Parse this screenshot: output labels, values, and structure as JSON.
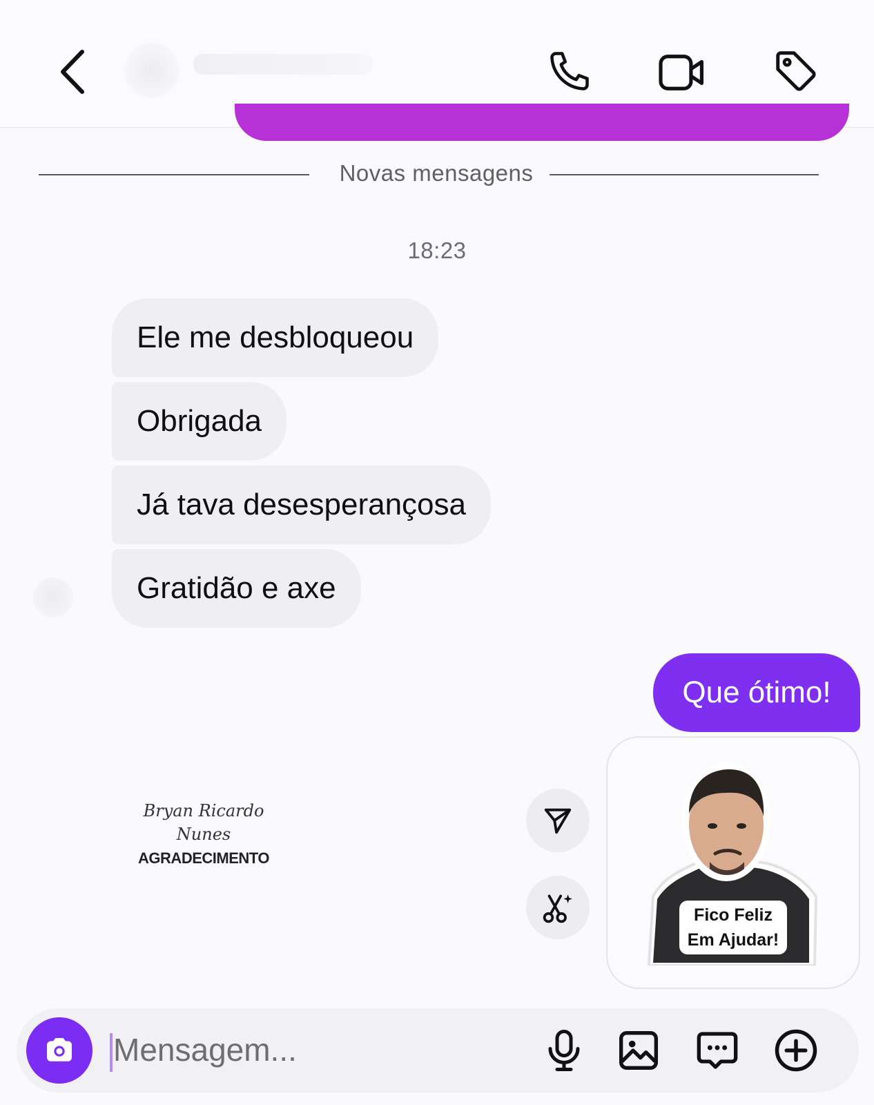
{
  "header": {
    "back_icon": "chevron-left-icon",
    "call_icon": "phone-icon",
    "video_icon": "video-camera-icon",
    "tag_icon": "tag-icon"
  },
  "chat": {
    "new_messages_label": "Novas mensagens",
    "timestamp": "18:23",
    "incoming": [
      "Ele me desbloqueou",
      "Obrigada",
      "Já tava desesperançosa",
      "Gratidão e axe"
    ],
    "outgoing": "Que ótimo!",
    "card": {
      "name_line1": "Bryan Ricardo",
      "name_line2": "Nunes",
      "caption": "AGRADECIMENTO"
    },
    "sticker": {
      "line1": "Fico Feliz",
      "line2": "Em Ajudar!"
    }
  },
  "composer": {
    "placeholder": "Mensagem...",
    "camera_icon": "camera-icon",
    "mic_icon": "microphone-icon",
    "gallery_icon": "image-icon",
    "chat_icon": "message-dots-icon",
    "add_icon": "plus-circle-icon"
  },
  "colors": {
    "accent": "#7e2ff0",
    "incoming_bubble": "#efeff3",
    "previous_bubble": "#b732d6"
  }
}
